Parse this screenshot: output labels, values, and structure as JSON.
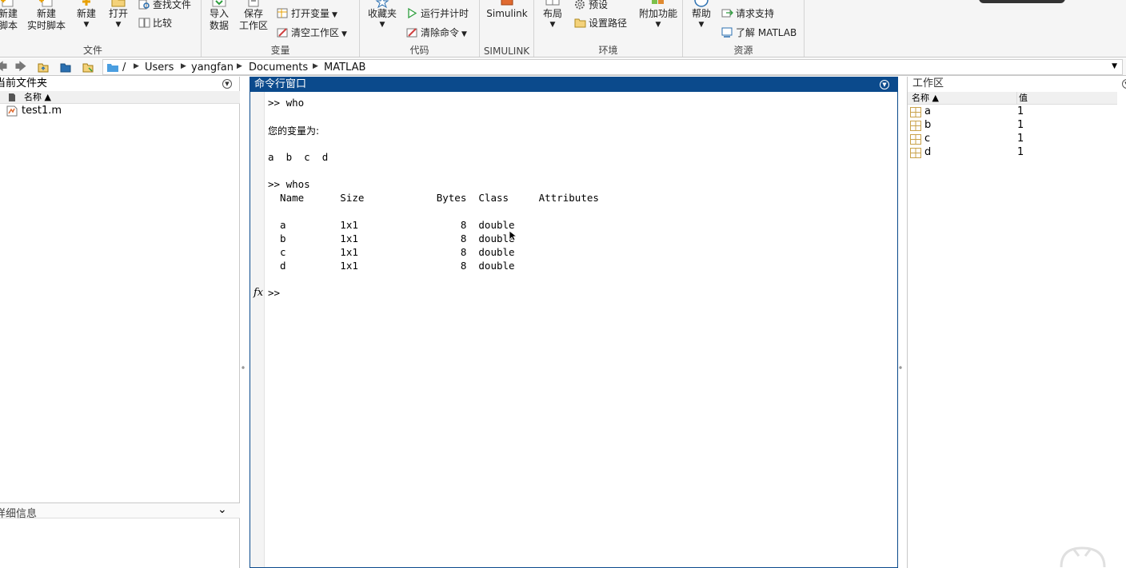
{
  "ribbon": {
    "file": {
      "new_script": [
        "新建",
        "脚本"
      ],
      "new_live_script": [
        "新建",
        "实时脚本"
      ],
      "new": "新建",
      "open": "打开",
      "find_files": "查找文件",
      "compare": "比较",
      "group_label": "文件"
    },
    "variable": {
      "import_data": [
        "导入",
        "数据"
      ],
      "save_workspace": [
        "保存",
        "工作区"
      ],
      "open_variable": "打开变量",
      "clear_workspace": "清空工作区",
      "group_label": "变量"
    },
    "code": {
      "favorites": "收藏夹",
      "run_and_time": "运行并计时",
      "clear_commands": "清除命令",
      "group_label": "代码"
    },
    "simulink": {
      "button": "Simulink",
      "group_label": "SIMULINK"
    },
    "environment": {
      "layout": "布局",
      "preferences": "预设",
      "set_path": "设置路径",
      "add_ons": "附加功能",
      "group_label": "环境"
    },
    "resources": {
      "help": "帮助",
      "request_support": "请求支持",
      "learn_matlab": "了解 MATLAB",
      "group_label": "资源"
    }
  },
  "address_bar": {
    "root": "/",
    "crumbs": [
      "Users",
      "yangfan",
      "Documents",
      "MATLAB"
    ]
  },
  "current_folder": {
    "title": "当前文件夹",
    "column_name": "名称 ▲",
    "files": [
      {
        "name": "test1.m",
        "icon": "matlab-script-icon"
      }
    ],
    "details_title": "详细信息"
  },
  "command_window": {
    "title": "命令行窗口",
    "lines": [
      ">> who",
      "",
      "您的变量为:",
      "",
      "a  b  c  d",
      "",
      ">> whos",
      "  Name      Size            Bytes  Class     Attributes",
      "",
      "  a         1x1                 8  double",
      "  b         1x1                 8  double",
      "  c         1x1                 8  double",
      "  d         1x1                 8  double",
      ""
    ],
    "prompt": ">>",
    "fx_label": "fx"
  },
  "workspace": {
    "title": "工作区",
    "col_name": "名称 ▲",
    "col_value": "值",
    "variables": [
      {
        "name": "a",
        "value": "1"
      },
      {
        "name": "b",
        "value": "1"
      },
      {
        "name": "c",
        "value": "1"
      },
      {
        "name": "d",
        "value": "1"
      }
    ]
  },
  "colors": {
    "accent": "#0b4a8c",
    "ribbon_bg": "#f5f5f5",
    "folder_blue": "#4a9ee0"
  }
}
